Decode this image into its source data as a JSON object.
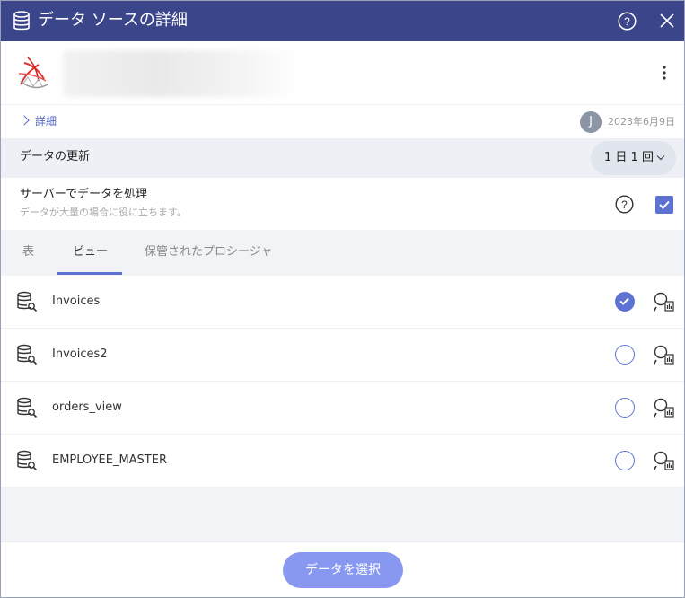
{
  "titlebar": {
    "title": "データ ソースの詳細",
    "icons": [
      "database-icon",
      "help-icon",
      "close-icon"
    ]
  },
  "source": {
    "logo_icon": "sql-server-logo-icon",
    "name_redacted": true
  },
  "details": {
    "link_label": "詳細",
    "avatar_initial": "J",
    "date": "2023年6月9日"
  },
  "refresh": {
    "label": "データの更新",
    "selected_value": "1 日 1 回"
  },
  "server_processing": {
    "title": "サーバーでデータを処理",
    "subtitle": "データが大量の場合に役に立ちます。",
    "checked": true
  },
  "tabs": [
    {
      "label": "表",
      "active": false
    },
    {
      "label": "ビュー",
      "active": true
    },
    {
      "label": "保管されたプロシージャ",
      "active": false
    }
  ],
  "views": [
    {
      "name": "Invoices",
      "selected": true
    },
    {
      "name": "Invoices2",
      "selected": false
    },
    {
      "name": "orders_view",
      "selected": false
    },
    {
      "name": "EMPLOYEE_MASTER",
      "selected": false
    }
  ],
  "footer": {
    "select_button": "データを選択"
  },
  "colors": {
    "titlebar": "#3b4589",
    "accent": "#5e72d4",
    "button": "#8898f0"
  }
}
